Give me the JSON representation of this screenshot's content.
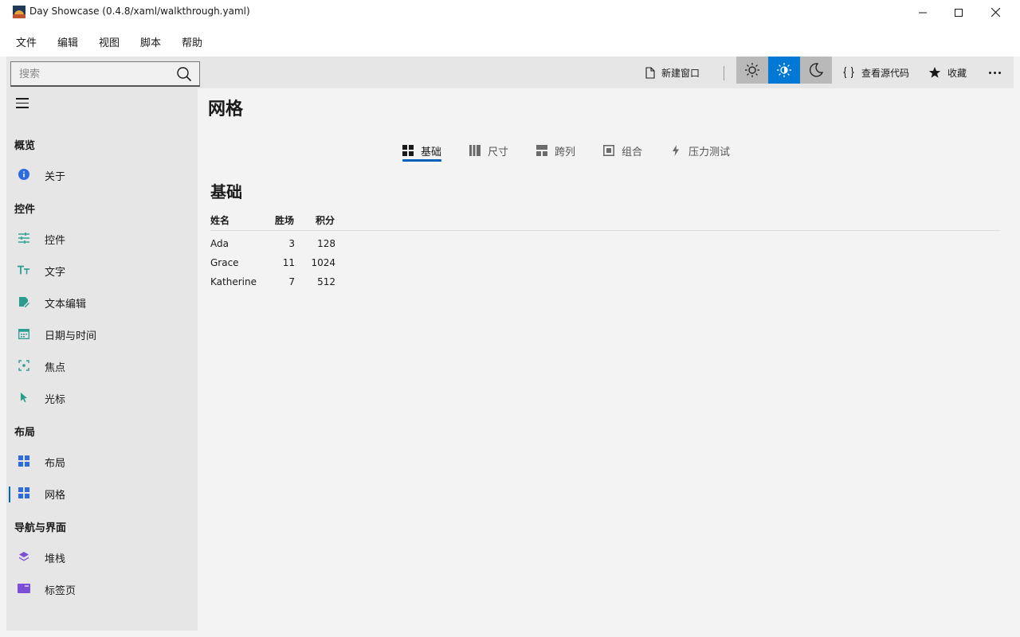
{
  "window": {
    "title": "Day Showcase (0.4.8/xaml/walkthrough.yaml)"
  },
  "menu": {
    "items": [
      "文件",
      "编辑",
      "视图",
      "脚本",
      "帮助"
    ]
  },
  "toolbar": {
    "search_placeholder": "搜索",
    "new_window_label": "新建窗口",
    "view_source_label": "查看源代码",
    "favorite_label": "收藏",
    "active_theme": "auto",
    "accent_color": "#0078d4"
  },
  "sidebar": {
    "sections": [
      {
        "label": "概览",
        "items": [
          {
            "label": "关于",
            "icon": "info-icon"
          }
        ]
      },
      {
        "label": "控件",
        "items": [
          {
            "label": "控件",
            "icon": "sliders-icon"
          },
          {
            "label": "文字",
            "icon": "text-icon"
          },
          {
            "label": "文本编辑",
            "icon": "edit-icon"
          },
          {
            "label": "日期与时间",
            "icon": "calendar-icon"
          },
          {
            "label": "焦点",
            "icon": "focus-icon"
          },
          {
            "label": "光标",
            "icon": "cursor-icon"
          }
        ]
      },
      {
        "label": "布局",
        "items": [
          {
            "label": "布局",
            "icon": "layout-icon"
          },
          {
            "label": "网格",
            "icon": "grid-icon",
            "selected": true
          }
        ]
      },
      {
        "label": "导航与界面",
        "items": [
          {
            "label": "堆栈",
            "icon": "stack-icon"
          },
          {
            "label": "标签页",
            "icon": "tabs-icon"
          }
        ]
      }
    ]
  },
  "main": {
    "page_title": "网格",
    "tabs": [
      {
        "label": "基础",
        "icon": "grid-icon",
        "active": true
      },
      {
        "label": "尺寸",
        "icon": "columns-icon"
      },
      {
        "label": "跨列",
        "icon": "span-icon"
      },
      {
        "label": "组合",
        "icon": "nested-icon"
      },
      {
        "label": "压力测试",
        "icon": "lightning-icon"
      }
    ],
    "section_heading": "基础",
    "table": {
      "headers": [
        "姓名",
        "胜场",
        "积分"
      ],
      "rows": [
        [
          "Ada",
          "3",
          "128"
        ],
        [
          "Grace",
          "11",
          "1024"
        ],
        [
          "Katherine",
          "7",
          "512"
        ]
      ]
    }
  }
}
